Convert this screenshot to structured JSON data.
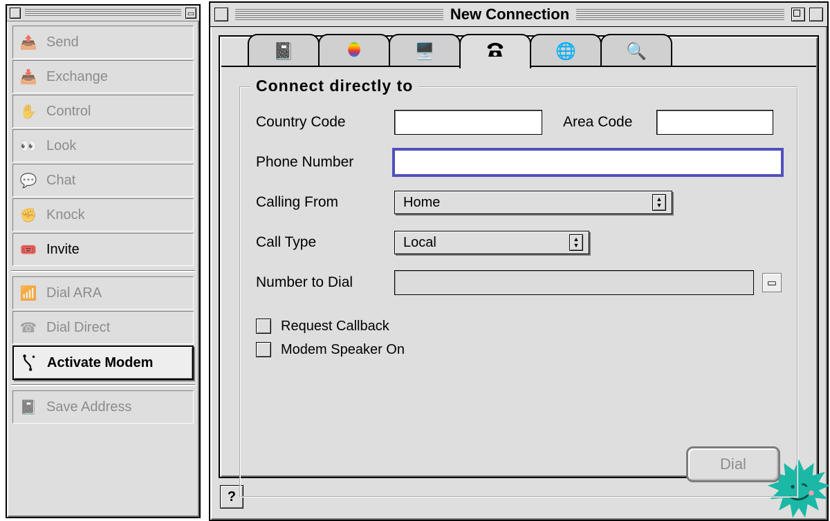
{
  "toolbox": {
    "items": [
      {
        "label": "Send",
        "icon": "send-icon"
      },
      {
        "label": "Exchange",
        "icon": "exchange-icon"
      },
      {
        "label": "Control",
        "icon": "control-icon"
      },
      {
        "label": "Look",
        "icon": "look-icon"
      },
      {
        "label": "Chat",
        "icon": "chat-icon"
      },
      {
        "label": "Knock",
        "icon": "knock-icon"
      },
      {
        "label": "Invite",
        "icon": "invite-icon"
      }
    ],
    "dial_items": [
      {
        "label": "Dial ARA",
        "icon": "dial-ara-icon"
      },
      {
        "label": "Dial Direct",
        "icon": "dial-direct-icon"
      },
      {
        "label": "Activate Modem",
        "icon": "activate-modem-icon"
      }
    ],
    "save_address": "Save Address"
  },
  "window": {
    "title": "New Connection",
    "tabs": [
      "address-book",
      "appletalk",
      "ara",
      "telephone",
      "internet",
      "search"
    ],
    "active_tab": 3,
    "group_title": "Connect directly to",
    "labels": {
      "country_code": "Country Code",
      "area_code": "Area Code",
      "phone_number": "Phone Number",
      "calling_from": "Calling From",
      "call_type": "Call Type",
      "number_to_dial": "Number to Dial",
      "request_callback": "Request Callback",
      "modem_speaker": "Modem Speaker On",
      "dial": "Dial"
    },
    "values": {
      "country_code": "",
      "area_code": "",
      "phone_number": "",
      "calling_from": "Home",
      "call_type": "Local",
      "number_to_dial": "",
      "request_callback": false,
      "modem_speaker": false
    }
  }
}
